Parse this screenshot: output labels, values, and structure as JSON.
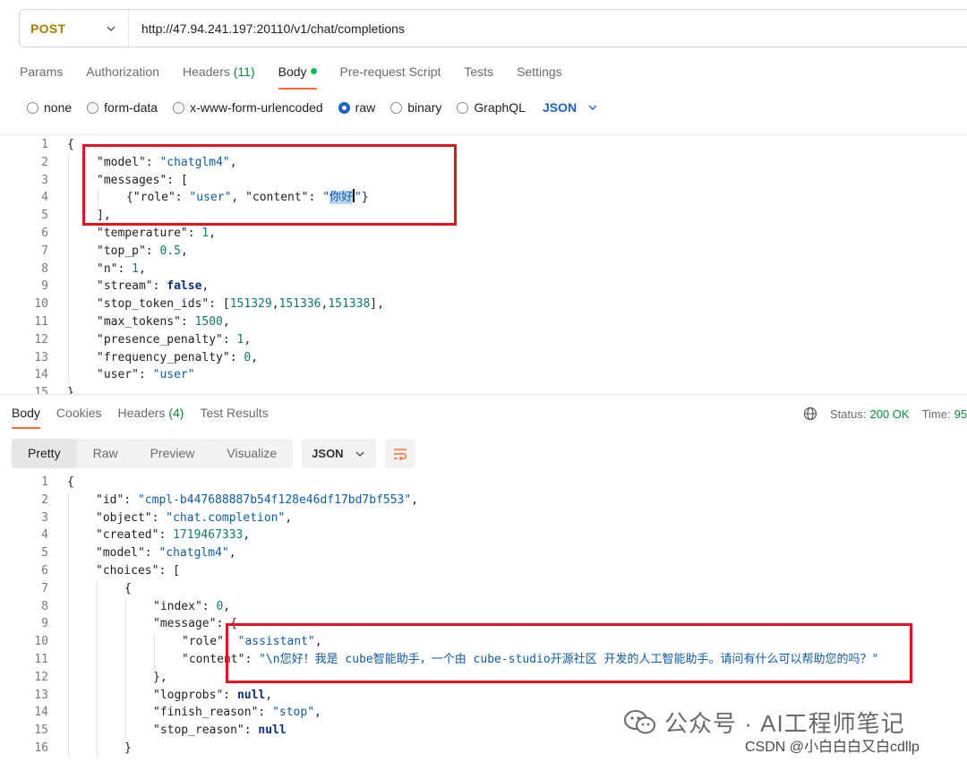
{
  "request": {
    "method": "POST",
    "url": "http://47.94.241.197:20110/v1/chat/completions"
  },
  "request_tabs": [
    {
      "label": "Params"
    },
    {
      "label": "Authorization"
    },
    {
      "label": "Headers",
      "count": "(11)"
    },
    {
      "label": "Body",
      "active": true
    },
    {
      "label": "Pre-request Script"
    },
    {
      "label": "Tests"
    },
    {
      "label": "Settings"
    }
  ],
  "body_types": {
    "options": [
      "none",
      "form-data",
      "x-www-form-urlencoded",
      "raw",
      "binary",
      "GraphQL"
    ],
    "selected": "raw",
    "format": "JSON"
  },
  "request_body_lines": [
    "{",
    "\"model\": \"chatglm4\",",
    "\"messages\": [",
    "{\"role\": \"user\", \"content\": \"你好\"}",
    "],",
    "\"temperature\": 1,",
    "\"top_p\": 0.5,",
    "\"n\": 1,",
    "\"stream\": false,",
    "\"stop_token_ids\": [151329,151336,151338],",
    "\"max_tokens\": 1500,",
    "\"presence_penalty\": 1,",
    "\"frequency_penalty\": 0,",
    "\"user\": \"user\"",
    "}"
  ],
  "response_tabs": [
    {
      "label": "Body",
      "active": true
    },
    {
      "label": "Cookies"
    },
    {
      "label": "Headers",
      "count": "(4)"
    },
    {
      "label": "Test Results"
    }
  ],
  "response_status": {
    "status_label": "Status:",
    "status_value": "200 OK",
    "time_label": "Time:",
    "time_value": "95"
  },
  "response_view": {
    "options": [
      "Pretty",
      "Raw",
      "Preview",
      "Visualize"
    ],
    "selected": "Pretty",
    "format": "JSON"
  },
  "response_body_lines": [
    "{",
    "\"id\": \"cmpl-b447688887b54f128e46df17bd7bf553\",",
    "\"object\": \"chat.completion\",",
    "\"created\": 1719467333,",
    "\"model\": \"chatglm4\",",
    "\"choices\": [",
    "{",
    "\"index\": 0,",
    "\"message\": {",
    "\"role\": \"assistant\",",
    "\"content\": \"\\n您好！我是 cube智能助手，一个由 cube-studio开源社区 开发的人工智能助手。请问有什么可以帮助您的吗？\"",
    "},",
    "\"logprobs\": null,",
    "\"finish_reason\": \"stop\",",
    "\"stop_reason\": null",
    "}"
  ],
  "watermark": {
    "text": "公众号 · AI工程师笔记",
    "csdn": "CSDN @小白白白又白cdllp"
  },
  "colors": {
    "accent": "#ff6c37",
    "method": "#ad7a03",
    "selected": "#1b62c7",
    "ok": "#0c8a3c",
    "highlight_box": "#e0141e"
  }
}
